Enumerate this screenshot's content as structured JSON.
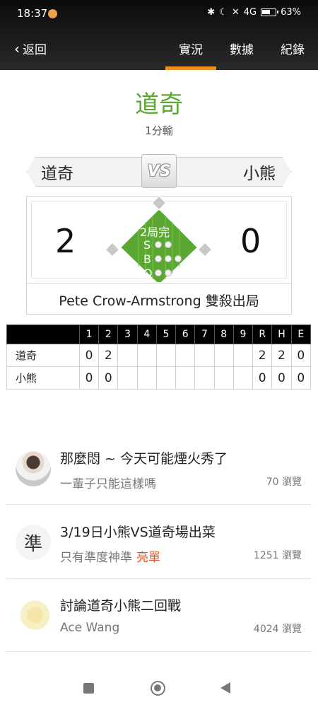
{
  "status_bar": {
    "time": "18:37",
    "icons": [
      "bluetooth-icon",
      "moon-icon",
      "mute-icon",
      "volte-icon",
      "signal-4g-icon",
      "battery-icon"
    ],
    "network": "4G",
    "battery_percent": "63%"
  },
  "nav": {
    "back_label": "返回",
    "tabs": [
      {
        "label": "實況",
        "active": true
      },
      {
        "label": "數據",
        "active": false
      },
      {
        "label": "紀錄",
        "active": false
      }
    ],
    "accent_color": "#f08f24"
  },
  "match": {
    "winner": "道奇",
    "result_text": "1分輸",
    "home_team": "道奇",
    "away_team": "小熊",
    "vs_label": "VS",
    "home_score": "2",
    "away_score": "0",
    "inning_status": "2局完",
    "count_labels": {
      "strike": "S",
      "ball": "B",
      "out": "O"
    },
    "count": {
      "strikes": 2,
      "balls": 3,
      "outs": 2
    },
    "last_play": "Pete Crow-Armstrong 雙殺出局",
    "field_color": "#5aa832"
  },
  "linescore": {
    "headers": [
      "1",
      "2",
      "3",
      "4",
      "5",
      "6",
      "7",
      "8",
      "9",
      "R",
      "H",
      "E"
    ],
    "rows": [
      {
        "team": "道奇",
        "cells": [
          "0",
          "2",
          "",
          "",
          "",
          "",
          "",
          "",
          "",
          "2",
          "2",
          "0"
        ]
      },
      {
        "team": "小熊",
        "cells": [
          "0",
          "0",
          "",
          "",
          "",
          "",
          "",
          "",
          "",
          "0",
          "0",
          "0"
        ]
      }
    ]
  },
  "posts": [
    {
      "title": "那麼悶 ~ 今天可能煙火秀了",
      "subtitle": "一輩子只能這樣嗎",
      "tag": "",
      "views": "70 瀏覽",
      "avatar_icon": "user-photo-avatar"
    },
    {
      "title": "3/19日小熊VS道奇場出菜",
      "subtitle": "只有準度神準",
      "tag": "亮單",
      "views": "1251 瀏覽",
      "avatar_icon": "zhun-character-avatar",
      "avatar_text": "準"
    },
    {
      "title": "討論道奇小熊二回戰",
      "subtitle": "Ace Wang",
      "tag": "",
      "views": "4024 瀏覽",
      "avatar_icon": "yellow-dragon-avatar"
    }
  ],
  "system_nav": [
    "recents-icon",
    "home-icon",
    "back-icon"
  ]
}
